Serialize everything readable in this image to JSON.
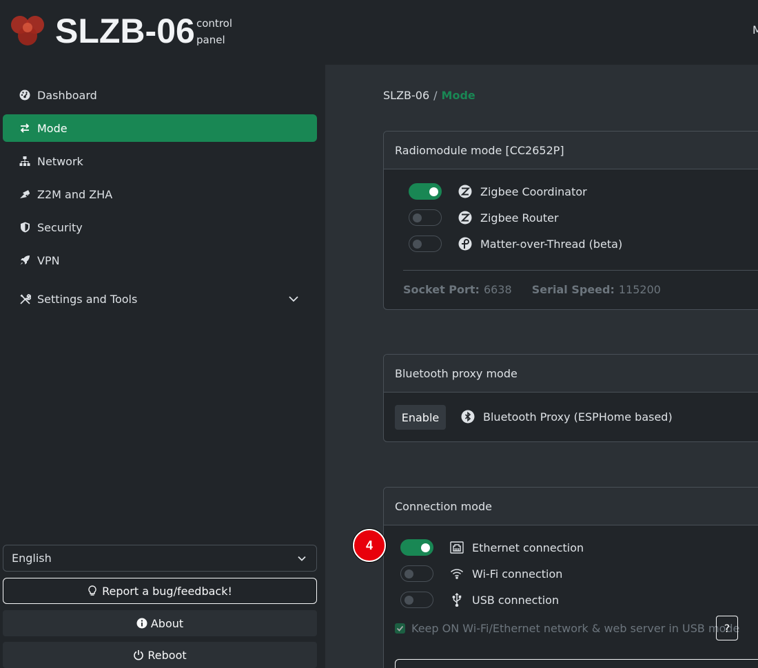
{
  "header": {
    "brand": "SLZB-06",
    "subtitle_line1": "control",
    "subtitle_line2": "panel",
    "right_text": "M"
  },
  "sidebar": {
    "items": [
      {
        "label": "Dashboard",
        "icon": "dashboard-gauge-icon"
      },
      {
        "label": "Mode",
        "icon": "arrows-exchange-icon",
        "active": true
      },
      {
        "label": "Network",
        "icon": "network-icon"
      },
      {
        "label": "Z2M and ZHA",
        "icon": "satellite-dish-icon"
      },
      {
        "label": "Security",
        "icon": "shield-icon"
      },
      {
        "label": "VPN",
        "icon": "rocket-icon"
      },
      {
        "label": "Settings and Tools",
        "icon": "tools-icon"
      }
    ],
    "language": "English",
    "report_label": "Report a bug/feedback!",
    "about_label": "About",
    "reboot_label": "Reboot"
  },
  "breadcrumb": {
    "root": "SLZB-06",
    "separator": "/",
    "current": "Mode"
  },
  "radio_card": {
    "title": "Radiomodule mode [CC2652P]",
    "options": [
      {
        "label": "Zigbee Coordinator",
        "on": true
      },
      {
        "label": "Zigbee Router",
        "on": false
      },
      {
        "label": "Matter-over-Thread (beta)",
        "on": false
      }
    ],
    "socket_port_label": "Socket Port:",
    "socket_port_value": "6638",
    "serial_speed_label": "Serial Speed:",
    "serial_speed_value": "115200"
  },
  "bluetooth_card": {
    "title": "Bluetooth proxy mode",
    "enable_label": "Enable",
    "proxy_label": "Bluetooth Proxy (ESPHome based)"
  },
  "connection_card": {
    "title": "Connection mode",
    "options": [
      {
        "label": "Ethernet connection",
        "on": true
      },
      {
        "label": "Wi-Fi connection",
        "on": false
      },
      {
        "label": "USB connection",
        "on": false
      }
    ],
    "keep_on_label": "Keep ON Wi-Fi/Ethernet network & web server in USB mode",
    "help_label": "?"
  },
  "annotation": {
    "badge": "4"
  },
  "colors": {
    "accent": "#198754",
    "badge": "#e8000b"
  }
}
